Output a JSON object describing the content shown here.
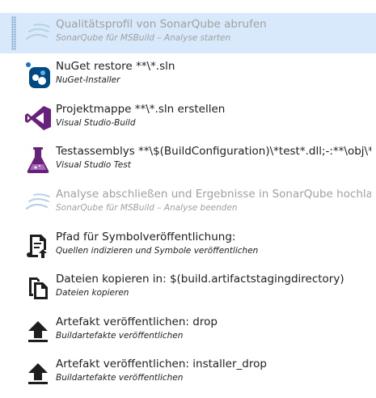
{
  "tasks": [
    {
      "title": "Qualitätsprofil von SonarQube abrufen",
      "subtitle": "SonarQube für MSBuild – Analyse starten",
      "icon": "sonarqube-icon",
      "state": "disabled-selected"
    },
    {
      "title": "NuGet restore **\\*.sln",
      "subtitle": "NuGet-Installer",
      "icon": "nuget-icon",
      "state": "enabled"
    },
    {
      "title": "Projektmappe **\\*.sln erstellen",
      "subtitle": "Visual Studio-Build",
      "icon": "visual-studio-icon",
      "state": "enabled"
    },
    {
      "title": "Testassemblys **\\$(BuildConfiguration)\\*test*.dll;-:**\\obj\\**",
      "subtitle": "Visual Studio Test",
      "icon": "flask-icon",
      "state": "enabled"
    },
    {
      "title": "Analyse abschließen und Ergebnisse in SonarQube hochladen",
      "subtitle": "SonarQube für MSBuild – Analyse beenden",
      "icon": "sonarqube-icon",
      "state": "disabled"
    },
    {
      "title": "Pfad für Symbolveröffentlichung:",
      "subtitle": "Quellen indizieren und Symbole veröffentlichen",
      "icon": "publish-symbols-icon",
      "state": "enabled"
    },
    {
      "title": "Dateien kopieren in: $(build.artifactstagingdirectory)",
      "subtitle": "Dateien kopieren",
      "icon": "copy-files-icon",
      "state": "enabled"
    },
    {
      "title": "Artefakt veröffentlichen: drop",
      "subtitle": "Buildartefakte veröffentlichen",
      "icon": "upload-icon",
      "state": "enabled"
    },
    {
      "title": "Artefakt veröffentlichen: installer_drop",
      "subtitle": "Buildartefakte veröffentlichen",
      "icon": "upload-icon",
      "state": "enabled"
    }
  ],
  "colors": {
    "selected_background": "#d7e9fb",
    "disabled_text": "#a0a0a0",
    "visual_studio_purple": "#68217a",
    "nuget_blue": "#004880"
  }
}
